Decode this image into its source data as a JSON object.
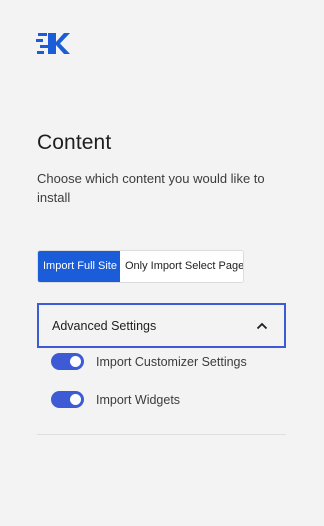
{
  "logo": {
    "icon": "kadence-logo-icon",
    "color": "#1b5cd8"
  },
  "content": {
    "title": "Content",
    "description": "Choose which content you would like to install"
  },
  "import_mode": {
    "options": [
      "Import Full Site",
      "Only Import Select Page"
    ],
    "selected": "Import Full Site"
  },
  "advanced": {
    "label": "Advanced Settings",
    "expanded": true,
    "chevron_icon": "chevron-up-icon",
    "options": [
      {
        "label": "Import Customizer Settings",
        "enabled": true
      },
      {
        "label": "Import Widgets",
        "enabled": true
      }
    ]
  },
  "colors": {
    "accent": "#3d5bd4",
    "active_button": "#1b5cd8",
    "background": "#f3f3f3"
  }
}
